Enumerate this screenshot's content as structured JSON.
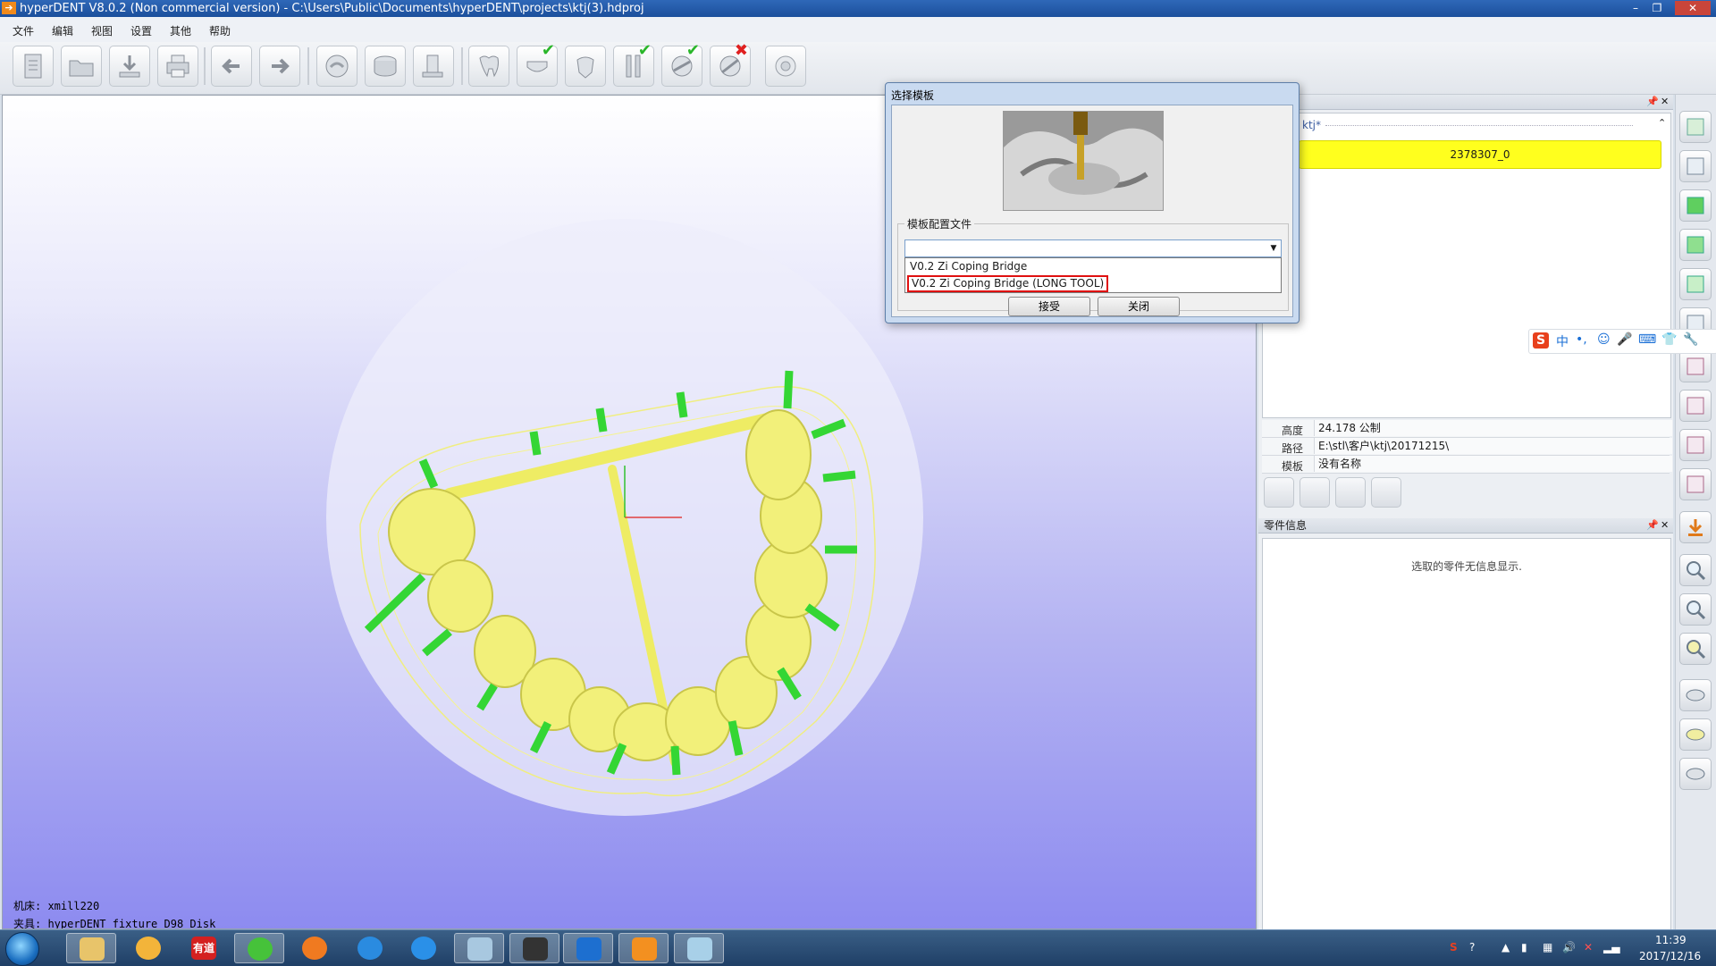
{
  "titlebar": {
    "title": "hyperDENT V8.0.2 (Non commercial version) - C:\\Users\\Public\\Documents\\hyperDENT\\projects\\ktj(3).hdproj",
    "minimize": "–",
    "restore": "❐",
    "close": "✕"
  },
  "menu": [
    "文件",
    "编辑",
    "视图",
    "设置",
    "其他",
    "帮助"
  ],
  "toolbar": {
    "icons": [
      "new-file-icon",
      "open-folder-icon",
      "save-icon",
      "print-icon",
      "back-arrow-icon",
      "forward-arrow-icon",
      "disk-icon",
      "stock-icon",
      "fixture-icon",
      "tooth-icon",
      "tooth-check-icon",
      "tooth-hand-icon",
      "tools-check-icon",
      "calc-check-icon",
      "calc-x-icon",
      "simulate-icon"
    ]
  },
  "viewport": {
    "machine": "机床: xmill220",
    "fixture": "夹具: hyperDENT_fixture_D98_Disk"
  },
  "project_panel": {
    "name": "ktj*",
    "selected_item": "2378307_0"
  },
  "properties": [
    {
      "key": "高度",
      "value": "24.178 公制"
    },
    {
      "key": "路径",
      "value": "E:\\stl\\客户\\ktj\\20171215\\"
    },
    {
      "key": "模板",
      "value": "没有名称"
    }
  ],
  "part_panel": {
    "title": "零件信息",
    "message": "选取的零件无信息显示."
  },
  "dialog": {
    "title": "选择模板",
    "group_label": "模板配置文件",
    "selected_value": "",
    "options": [
      "V0.2 Zi Coping Bridge",
      "V0.2 Zi Coping Bridge (LONG TOOL)"
    ],
    "ok_button": "接受",
    "close_button": "关闭"
  },
  "ime": {
    "logo": "S",
    "items": [
      "中",
      "•,",
      "☺",
      "🎤",
      "⌨",
      "👕",
      "🔧"
    ]
  },
  "taskbar": {
    "apps": [
      "explorer",
      "paint",
      "youdao",
      "wechat",
      "firefox",
      "qq-browser",
      "feishu",
      "notepad",
      "hyperdent-cam",
      "teamviewer",
      "hyperdent",
      "sketch"
    ],
    "youdao_label": "有道",
    "clock_time": "11:39",
    "clock_date": "2017/12/16"
  },
  "colors": {
    "highlight_yellow": "#ffff1e",
    "model_yellow": "#f2f07a",
    "connector_green": "#34d634",
    "selection_red": "#e01010"
  }
}
